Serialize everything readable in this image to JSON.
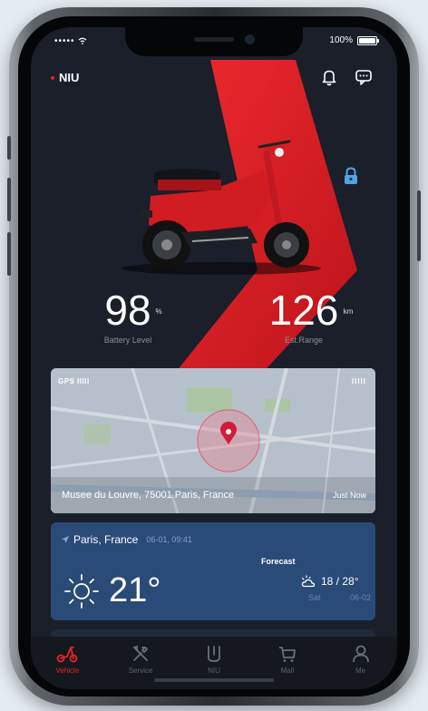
{
  "status_bar": {
    "signal": "••••• ",
    "battery": "100%"
  },
  "brand": {
    "name": "NIU"
  },
  "icons": {
    "bell": "bell-icon",
    "chat": "chat-bubble-icon",
    "lock": "lock-icon"
  },
  "colors": {
    "accent": "#e5242a",
    "background": "#1a1f2a",
    "card": "#2a4a78"
  },
  "metrics": {
    "battery": {
      "value": "98",
      "unit": "%",
      "label": "Battery Level"
    },
    "range": {
      "value": "126",
      "unit": "km",
      "label": "Est.Range"
    }
  },
  "map": {
    "gps_label": "GPS IIIII",
    "signal": "IIIII",
    "address": "Musee du Louvre, 75001 Paris, France",
    "time": "Just Now"
  },
  "weather": {
    "location": "Paris, France",
    "timestamp": "06-01, 09:41",
    "temperature": "21°",
    "forecast_label": "Forecast",
    "forecast_range": "18 / 28°",
    "forecast_day": "Sat",
    "forecast_date": "06-02"
  },
  "tabs": [
    {
      "label": "Vehicle",
      "icon": "scooter-icon",
      "active": true
    },
    {
      "label": "Service",
      "icon": "wrench-icon",
      "active": false
    },
    {
      "label": "NIU",
      "icon": "niu-logo-icon",
      "active": false
    },
    {
      "label": "Mall",
      "icon": "cart-icon",
      "active": false
    },
    {
      "label": "Me",
      "icon": "person-icon",
      "active": false
    }
  ]
}
